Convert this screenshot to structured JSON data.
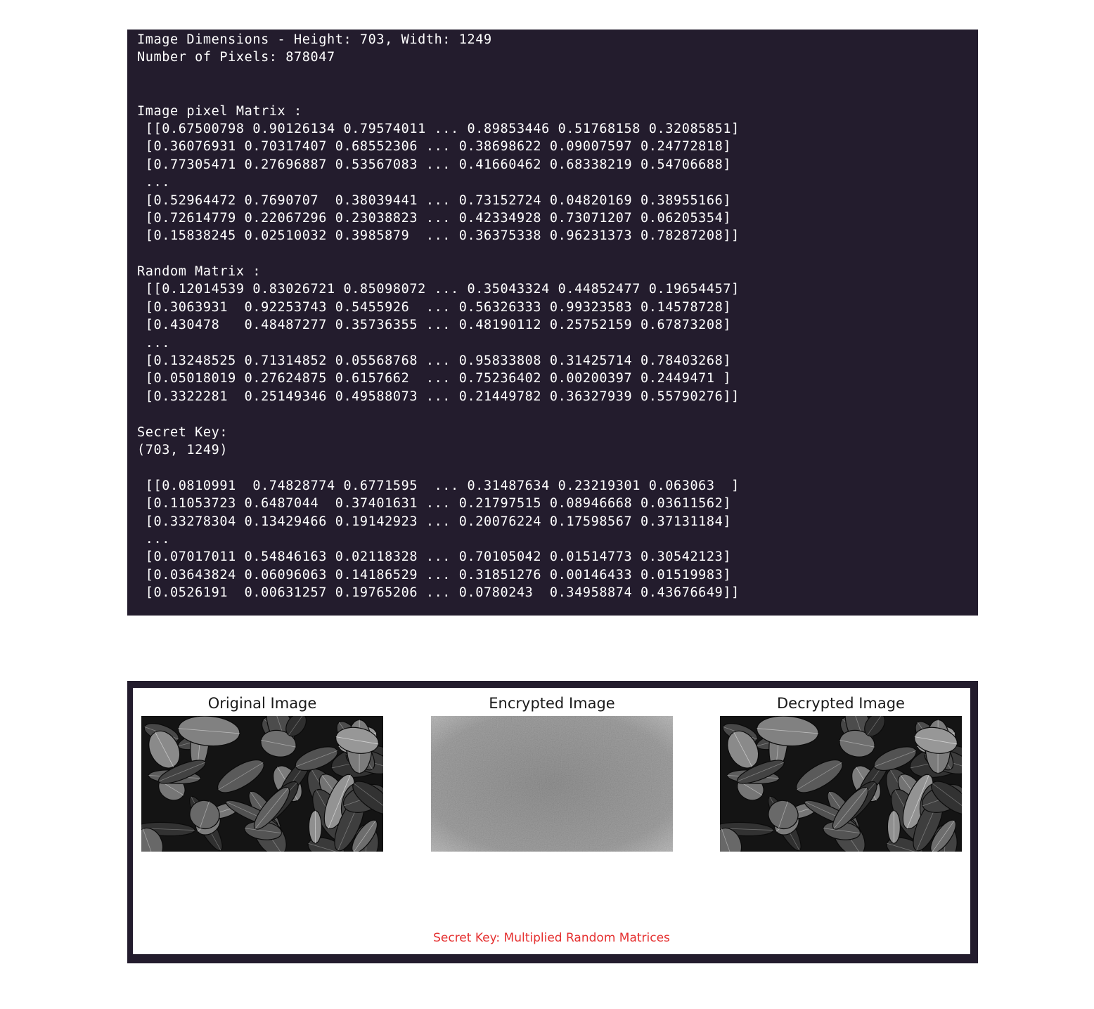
{
  "terminal": {
    "lines": [
      "Image Dimensions - Height: 703, Width: 1249",
      "Number of Pixels: 878047",
      "",
      "",
      "Image pixel Matrix :",
      " [[0.67500798 0.90126134 0.79574011 ... 0.89853446 0.51768158 0.32085851]",
      " [0.36076931 0.70317407 0.68552306 ... 0.38698622 0.09007597 0.24772818]",
      " [0.77305471 0.27696887 0.53567083 ... 0.41660462 0.68338219 0.54706688]",
      " ...",
      " [0.52964472 0.7690707  0.38039441 ... 0.73152724 0.04820169 0.38955166]",
      " [0.72614779 0.22067296 0.23038823 ... 0.42334928 0.73071207 0.06205354]",
      " [0.15838245 0.02510032 0.3985879  ... 0.36375338 0.96231373 0.78287208]]",
      "",
      "Random Matrix :",
      " [[0.12014539 0.83026721 0.85098072 ... 0.35043324 0.44852477 0.19654457]",
      " [0.3063931  0.92253743 0.5455926  ... 0.56326333 0.99323583 0.14578728]",
      " [0.430478   0.48487277 0.35736355 ... 0.48190112 0.25752159 0.67873208]",
      " ...",
      " [0.13248525 0.71314852 0.05568768 ... 0.95833808 0.31425714 0.78403268]",
      " [0.05018019 0.27624875 0.6157662  ... 0.75236402 0.00200397 0.2449471 ]",
      " [0.3322281  0.25149346 0.49588073 ... 0.21449782 0.36327939 0.55790276]]",
      "",
      "Secret Key:",
      "(703, 1249)",
      "",
      " [[0.0810991  0.74828774 0.6771595  ... 0.31487634 0.23219301 0.063063  ]",
      " [0.11053723 0.6487044  0.37401631 ... 0.21797515 0.08946668 0.03611562]",
      " [0.33278304 0.13429466 0.19142923 ... 0.20076224 0.17598567 0.37131184]",
      " ...",
      " [0.07017011 0.54846163 0.02118328 ... 0.70105042 0.01514773 0.30542123]",
      " [0.03643824 0.06096063 0.14186529 ... 0.31851276 0.00146433 0.01519983]",
      " [0.0526191  0.00631257 0.19765206 ... 0.0780243  0.34958874 0.43676649]]"
    ]
  },
  "figure": {
    "panels": [
      {
        "title": "Original Image",
        "kind": "leaves"
      },
      {
        "title": "Encrypted Image",
        "kind": "noise"
      },
      {
        "title": "Decrypted Image",
        "kind": "leaves"
      }
    ],
    "caption": "Secret Key: Multiplied Random Matrices",
    "caption_color": "#e53030"
  },
  "colors": {
    "terminal_bg": "#231c2d",
    "terminal_text": "#ffffff"
  }
}
